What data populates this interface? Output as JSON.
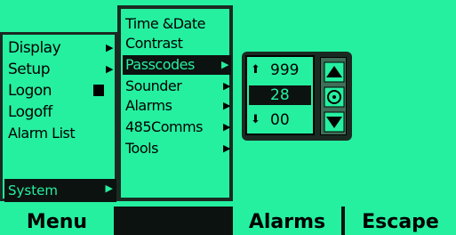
{
  "main_menu": {
    "items": [
      {
        "label": "Display",
        "has_submenu": true
      },
      {
        "label": "Setup",
        "has_submenu": true
      },
      {
        "label": "Logon",
        "has_submenu": false
      },
      {
        "label": "Logoff",
        "has_submenu": false
      },
      {
        "label": "Alarm List",
        "has_submenu": false
      }
    ],
    "selected_label": "System"
  },
  "system_menu": {
    "items": [
      {
        "label": "Time &Date"
      },
      {
        "label": "Contrast"
      },
      {
        "label": "Passcodes"
      },
      {
        "label": "Sounder"
      },
      {
        "label": "Alarms"
      },
      {
        "label": "485Comms"
      },
      {
        "label": "Tools"
      }
    ],
    "selected_label": "Passcodes"
  },
  "passcode_editor": {
    "upper_value": "999",
    "current_value": "28",
    "lower_value": "00"
  },
  "softkeys": {
    "key1": "Menu",
    "key2": "",
    "key3": "Alarms",
    "key4": "Escape"
  },
  "colors": {
    "lcd_background": "#25f0a0",
    "lcd_dark": "#0c1210"
  }
}
